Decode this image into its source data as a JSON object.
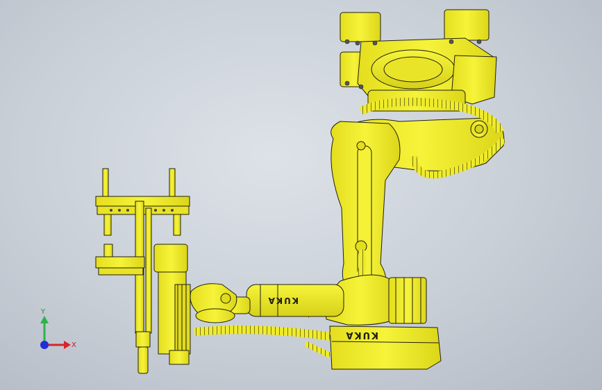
{
  "colors": {
    "part_yellow": "#f0ee2a",
    "part_yellow_dark": "#d9d41a",
    "edge": "#1e1e10",
    "axis_x": "#d8232a",
    "axis_y": "#2db34a",
    "axis_z": "#1f2fd6"
  },
  "robot": {
    "brand_upper_arm": "KUKA",
    "brand_motor_box": "KUKA"
  },
  "triad": {
    "x_label": "X",
    "y_label": "Y"
  }
}
